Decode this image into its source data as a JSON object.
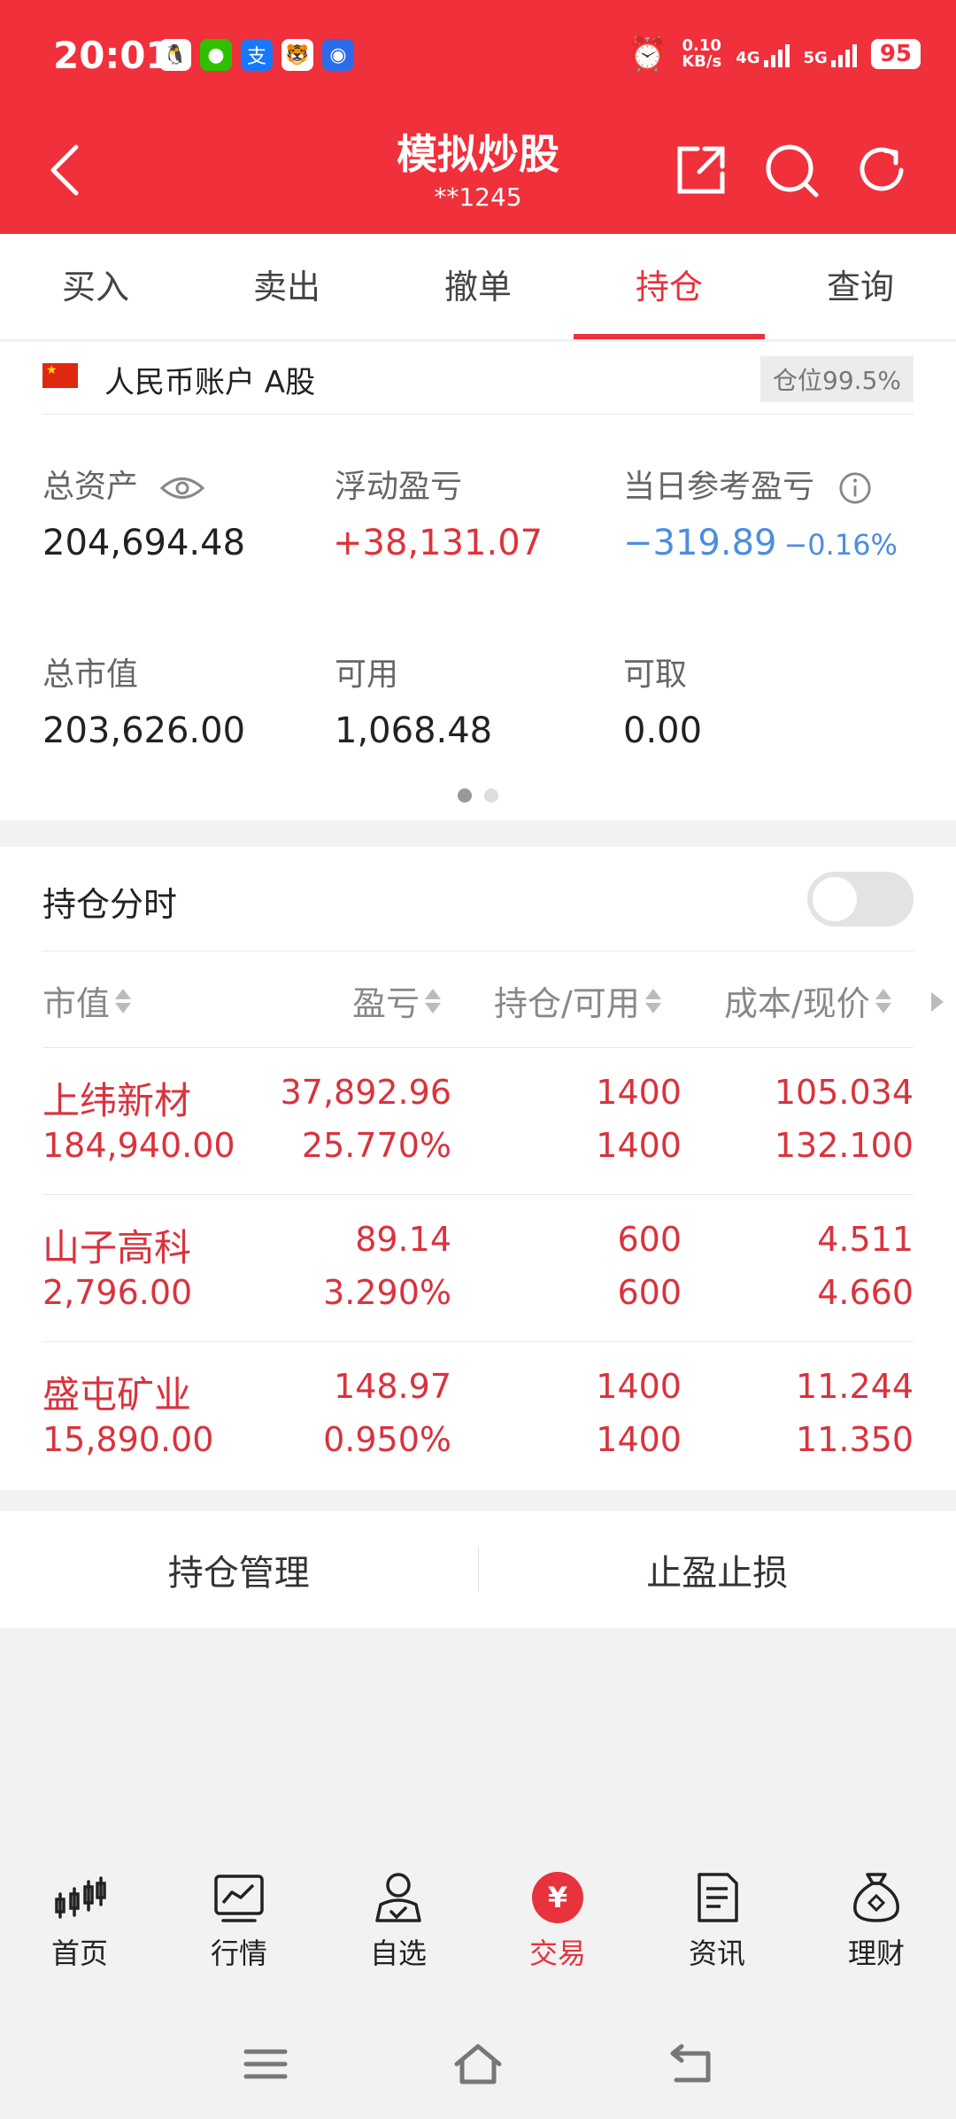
{
  "status_bar": {
    "time": "20:01",
    "app_icons": [
      "qq-icon",
      "wechat-icon",
      "alipay-icon",
      "tiger-app-icon",
      "browser-icon"
    ],
    "speed_value": "0.10",
    "speed_unit": "KB/s",
    "net1": "4G",
    "net2": "5G",
    "battery": "95"
  },
  "header": {
    "title": "模拟炒股",
    "account_masked": "**1245"
  },
  "tabs": [
    "买入",
    "卖出",
    "撤单",
    "持仓",
    "查询"
  ],
  "active_tab": 3,
  "account": {
    "name": "人民币账户 A股",
    "position_badge": "仓位99.5%",
    "total_assets_label": "总资产",
    "total_assets": "204,694.48",
    "floating_pl_label": "浮动盈亏",
    "floating_pl": "+38,131.07",
    "daily_ref_pl_label": "当日参考盈亏",
    "daily_ref_pl": "−319.89",
    "daily_ref_pl_pct": "−0.16%",
    "market_value_label": "总市值",
    "market_value": "203,626.00",
    "available_label": "可用",
    "available": "1,068.48",
    "withdrawable_label": "可取",
    "withdrawable": "0.00"
  },
  "positions": {
    "title": "持仓分时",
    "columns": [
      "市值",
      "盈亏",
      "持仓/可用",
      "成本/现价"
    ],
    "rows": [
      {
        "name": "上纬新材",
        "market_value": "184,940.00",
        "pl": "37,892.96",
        "pl_pct": "25.770%",
        "holding": "1400",
        "available": "1400",
        "cost": "105.034",
        "price": "132.100"
      },
      {
        "name": "山子高科",
        "market_value": "2,796.00",
        "pl": "89.14",
        "pl_pct": "3.290%",
        "holding": "600",
        "available": "600",
        "cost": "4.511",
        "price": "4.660"
      },
      {
        "name": "盛屯矿业",
        "market_value": "15,890.00",
        "pl": "148.97",
        "pl_pct": "0.950%",
        "holding": "1400",
        "available": "1400",
        "cost": "11.244",
        "price": "11.350"
      }
    ]
  },
  "actions": [
    "持仓管理",
    "止盈止损"
  ],
  "bottom_nav": [
    "首页",
    "行情",
    "自选",
    "交易",
    "资讯",
    "理财"
  ],
  "bottom_nav_active": 3,
  "colors": {
    "brand_red": "#f0303b",
    "profit_red": "#d9333d",
    "loss_blue": "#4b8ee0"
  }
}
